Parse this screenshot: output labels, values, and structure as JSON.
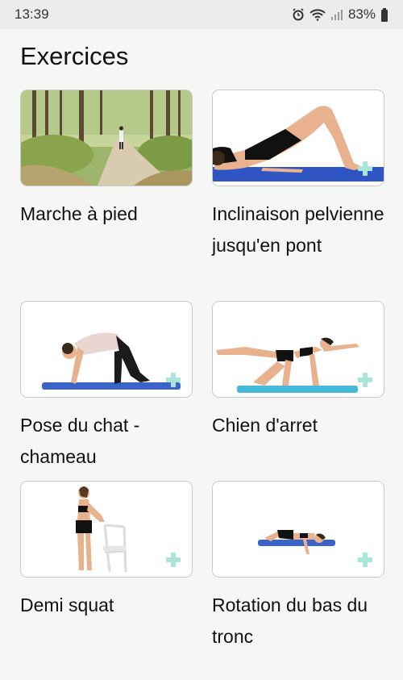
{
  "status": {
    "time": "13:39",
    "battery": "83%"
  },
  "title": "Exercices",
  "exercises": [
    {
      "label": "Marche à pied"
    },
    {
      "label": "Inclinaison pelvienne jusqu'en pont"
    },
    {
      "label": "Pose du chat - chameau"
    },
    {
      "label": "Chien d'arret"
    },
    {
      "label": "Demi squat"
    },
    {
      "label": "Rotation du bas du tronc"
    }
  ],
  "icons": [
    "alarm-icon",
    "wifi-icon",
    "signal-icon",
    "battery-icon",
    "plus-icon"
  ]
}
